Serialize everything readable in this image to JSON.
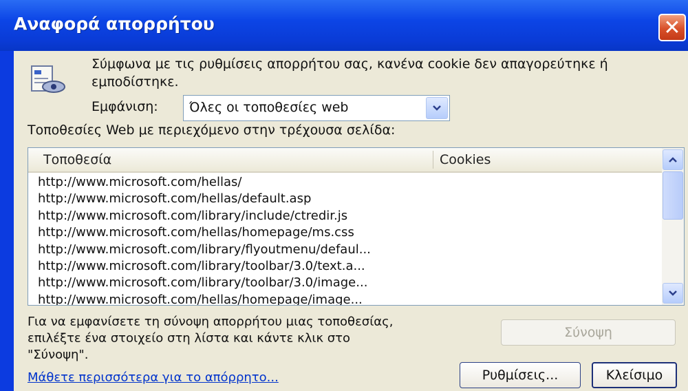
{
  "window": {
    "title": "Αναφορά απορρήτου"
  },
  "info": {
    "text": "Σύμφωνα με τις ρυθμίσεις απορρήτου σας, κανένα cookie δεν απαγορεύτηκε ή εμποδίστηκε."
  },
  "filter": {
    "label": "Εμφάνιση:",
    "selected": "Όλες οι τοποθεσίες web"
  },
  "sites_label": "Τοποθεσίες Web με περιεχόμενο στην τρέχουσα σελίδα:",
  "list": {
    "columns": [
      "Τοποθεσία",
      "Cookies"
    ],
    "rows": [
      "http://www.microsoft.com/hellas/",
      "http://www.microsoft.com/hellas/default.asp",
      "http://www.microsoft.com/library/include/ctredir.js",
      "http://www.microsoft.com/hellas/homepage/ms.css",
      "http://www.microsoft.com/library/flyoutmenu/defaul...",
      "http://www.microsoft.com/library/toolbar/3.0/text.a...",
      "http://www.microsoft.com/library/toolbar/3.0/image...",
      "http://www.microsoft.com/hellas/homepage/image..."
    ]
  },
  "help_text": "Για να εμφανίσετε τη σύνοψη απορρήτου μιας τοποθεσίας, επιλέξτε ένα στοιχείο στη λίστα και κάντε κλικ στο \"Σύνοψη\".",
  "buttons": {
    "summary": "Σύνοψη",
    "settings": "Ρυθμίσεις...",
    "close": "Κλείσιμο"
  },
  "learn_more": "Μάθετε περισσότερα για το απόρρητο...",
  "colors": {
    "titlebar": "#0c45e6",
    "dialog_bg": "#ece9d8",
    "link": "#0033cc"
  },
  "icons": {
    "info": "privacy-report-icon",
    "close": "close-icon",
    "dropdown": "chevron-down-icon"
  }
}
